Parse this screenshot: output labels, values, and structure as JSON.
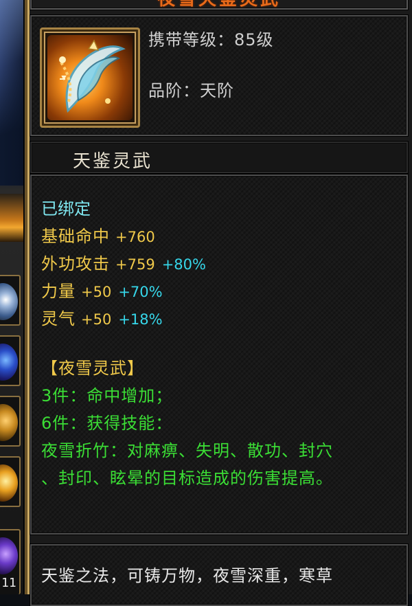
{
  "tooltip": {
    "title": "夜雪天鉴灵武",
    "carry_level": "携带等级：85级",
    "grade": "品阶：天阶",
    "item_name": "天鉴灵武",
    "bound": "已绑定",
    "attributes": [
      {
        "name": "基础命中",
        "value": "+760",
        "pct": ""
      },
      {
        "name": "外功攻击",
        "value": "+759",
        "pct": "+80%"
      },
      {
        "name": "力量",
        "value": "+50",
        "pct": "+70%"
      },
      {
        "name": "灵气",
        "value": "+50",
        "pct": "+18%"
      }
    ],
    "set": {
      "title": "【夜雪灵武】",
      "lines": [
        "3件：命中增加；",
        "6件：获得技能：",
        "夜雪折竹：对麻痹、失明、散功、封穴",
        "、封印、眩晕的目标造成的伤害提高。"
      ]
    },
    "description": "天鉴之法，可铸万物，夜雪深重，寒草"
  },
  "left_strip": {
    "slot_count": "11"
  },
  "colors": {
    "gold_text": "#f0c94a",
    "cyan_pct": "#36d7ea",
    "green_set": "#3bde35",
    "bound_cyan": "#7fe7f0",
    "title_orange": "#e86a1a"
  },
  "icons": {
    "item_icon": "spirit-weapon-icon"
  }
}
